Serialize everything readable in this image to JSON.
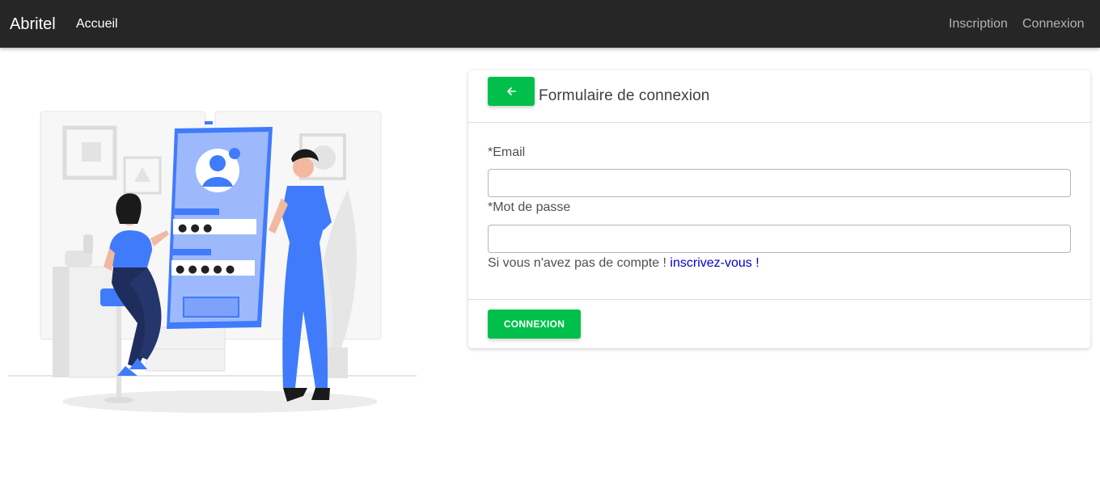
{
  "navbar": {
    "brand": "Abritel",
    "home": "Accueil",
    "signup": "Inscription",
    "login": "Connexion"
  },
  "illustration": {
    "password_dots_1": "● ● ●",
    "password_dots_2": "● ● ● ● ●"
  },
  "form": {
    "title": "Formulaire de connexion",
    "back_icon": "arrow-left-icon",
    "email_label": "*Email",
    "email_value": "",
    "password_label": "*Mot de passe",
    "password_value": "",
    "hint_text": "Si vous n'avez pas de compte !",
    "hint_link": "inscrivez-vous !",
    "submit_label": "CONNEXION"
  },
  "colors": {
    "navbar_bg": "#262626",
    "accent_green": "#00c04b",
    "link_blue": "#0000cc",
    "illustration_blue": "#3f7bfb"
  }
}
